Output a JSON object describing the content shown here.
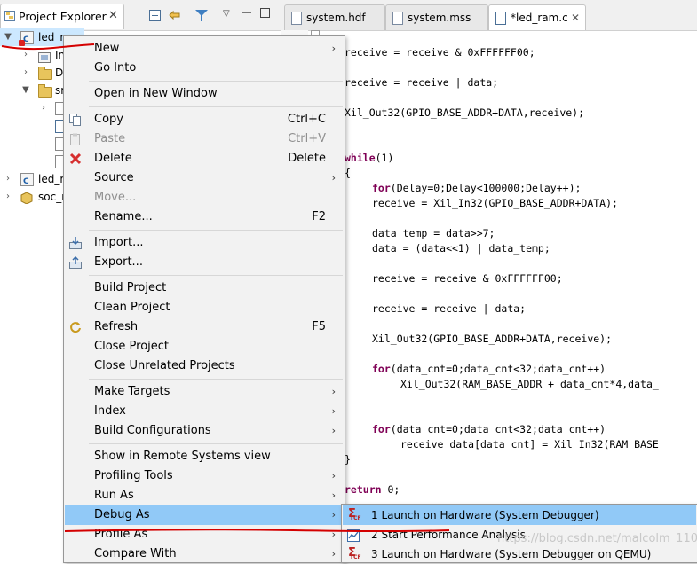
{
  "explorer": {
    "title": "Project Explorer",
    "tree": [
      {
        "label": "led_ram"
      },
      {
        "label": "In"
      },
      {
        "label": "D"
      },
      {
        "label": "sr"
      },
      {
        "label": "led_r"
      },
      {
        "label": "soc_r"
      }
    ]
  },
  "editor": {
    "tabs": [
      {
        "label": "system.hdf"
      },
      {
        "label": "system.mss"
      },
      {
        "label": "*led_ram.c"
      }
    ],
    "code": [
      "receive = receive & 0xFFFFFF00;",
      "receive = receive | data;",
      "Xil_Out32(GPIO_BASE_ADDR+DATA,receive);",
      "while",
      "(1)",
      "{",
      "for",
      "(Delay=0;Delay<100000;Delay++);",
      "receive = Xil_In32(GPIO_BASE_ADDR+DATA);",
      "data_temp = data>>7;",
      "data = (data<<1) | data_temp;",
      "receive = receive & 0xFFFFFF00;",
      "receive = receive | data;",
      "Xil_Out32(GPIO_BASE_ADDR+DATA,receive);",
      "for",
      "(data_cnt=0;data_cnt<32;data_cnt++)",
      "Xil_Out32(RAM_BASE_ADDR + data_cnt*4,data_",
      "for",
      "(data_cnt=0;data_cnt<32;data_cnt++)",
      "receive_data[data_cnt] = Xil_In32(RAM_BASE",
      "}",
      "return",
      "0;"
    ]
  },
  "context_menu": {
    "items": [
      {
        "label": "New",
        "shortcut": "",
        "submenu": true
      },
      {
        "label": "Go Into",
        "shortcut": ""
      },
      {
        "label": "Open in New Window",
        "shortcut": ""
      },
      {
        "label": "Copy",
        "shortcut": "Ctrl+C"
      },
      {
        "label": "Paste",
        "shortcut": "Ctrl+V",
        "disabled": true
      },
      {
        "label": "Delete",
        "shortcut": "Delete"
      },
      {
        "label": "Source",
        "shortcut": "",
        "submenu": true
      },
      {
        "label": "Move...",
        "shortcut": "",
        "disabled": true
      },
      {
        "label": "Rename...",
        "shortcut": "F2"
      },
      {
        "label": "Import...",
        "shortcut": ""
      },
      {
        "label": "Export...",
        "shortcut": ""
      },
      {
        "label": "Build Project",
        "shortcut": ""
      },
      {
        "label": "Clean Project",
        "shortcut": ""
      },
      {
        "label": "Refresh",
        "shortcut": "F5"
      },
      {
        "label": "Close Project",
        "shortcut": ""
      },
      {
        "label": "Close Unrelated Projects",
        "shortcut": ""
      },
      {
        "label": "Make Targets",
        "shortcut": "",
        "submenu": true
      },
      {
        "label": "Index",
        "shortcut": "",
        "submenu": true
      },
      {
        "label": "Build Configurations",
        "shortcut": "",
        "submenu": true
      },
      {
        "label": "Show in Remote Systems view",
        "shortcut": ""
      },
      {
        "label": "Profiling Tools",
        "shortcut": "",
        "submenu": true
      },
      {
        "label": "Run As",
        "shortcut": "",
        "submenu": true
      },
      {
        "label": "Debug As",
        "shortcut": "",
        "submenu": true,
        "highlighted": true
      },
      {
        "label": "Profile As",
        "shortcut": "",
        "submenu": true
      },
      {
        "label": "Compare With",
        "shortcut": "",
        "submenu": true
      }
    ]
  },
  "debug_submenu": {
    "items": [
      {
        "label": "1 Launch on Hardware (System Debugger)",
        "highlighted": true
      },
      {
        "label": "2 Start Performance Analysis"
      },
      {
        "label": "3 Launch on Hardware (System Debugger on QEMU)"
      }
    ]
  },
  "icon_text": "TCF",
  "watermark": "https://blog.csdn.net/malcolm_110",
  "colors": {
    "menu_highlight": "#91c9f7",
    "tree_selection": "#cce8ff",
    "annotation_red": "#d40000",
    "keyword": "#7f0055"
  }
}
